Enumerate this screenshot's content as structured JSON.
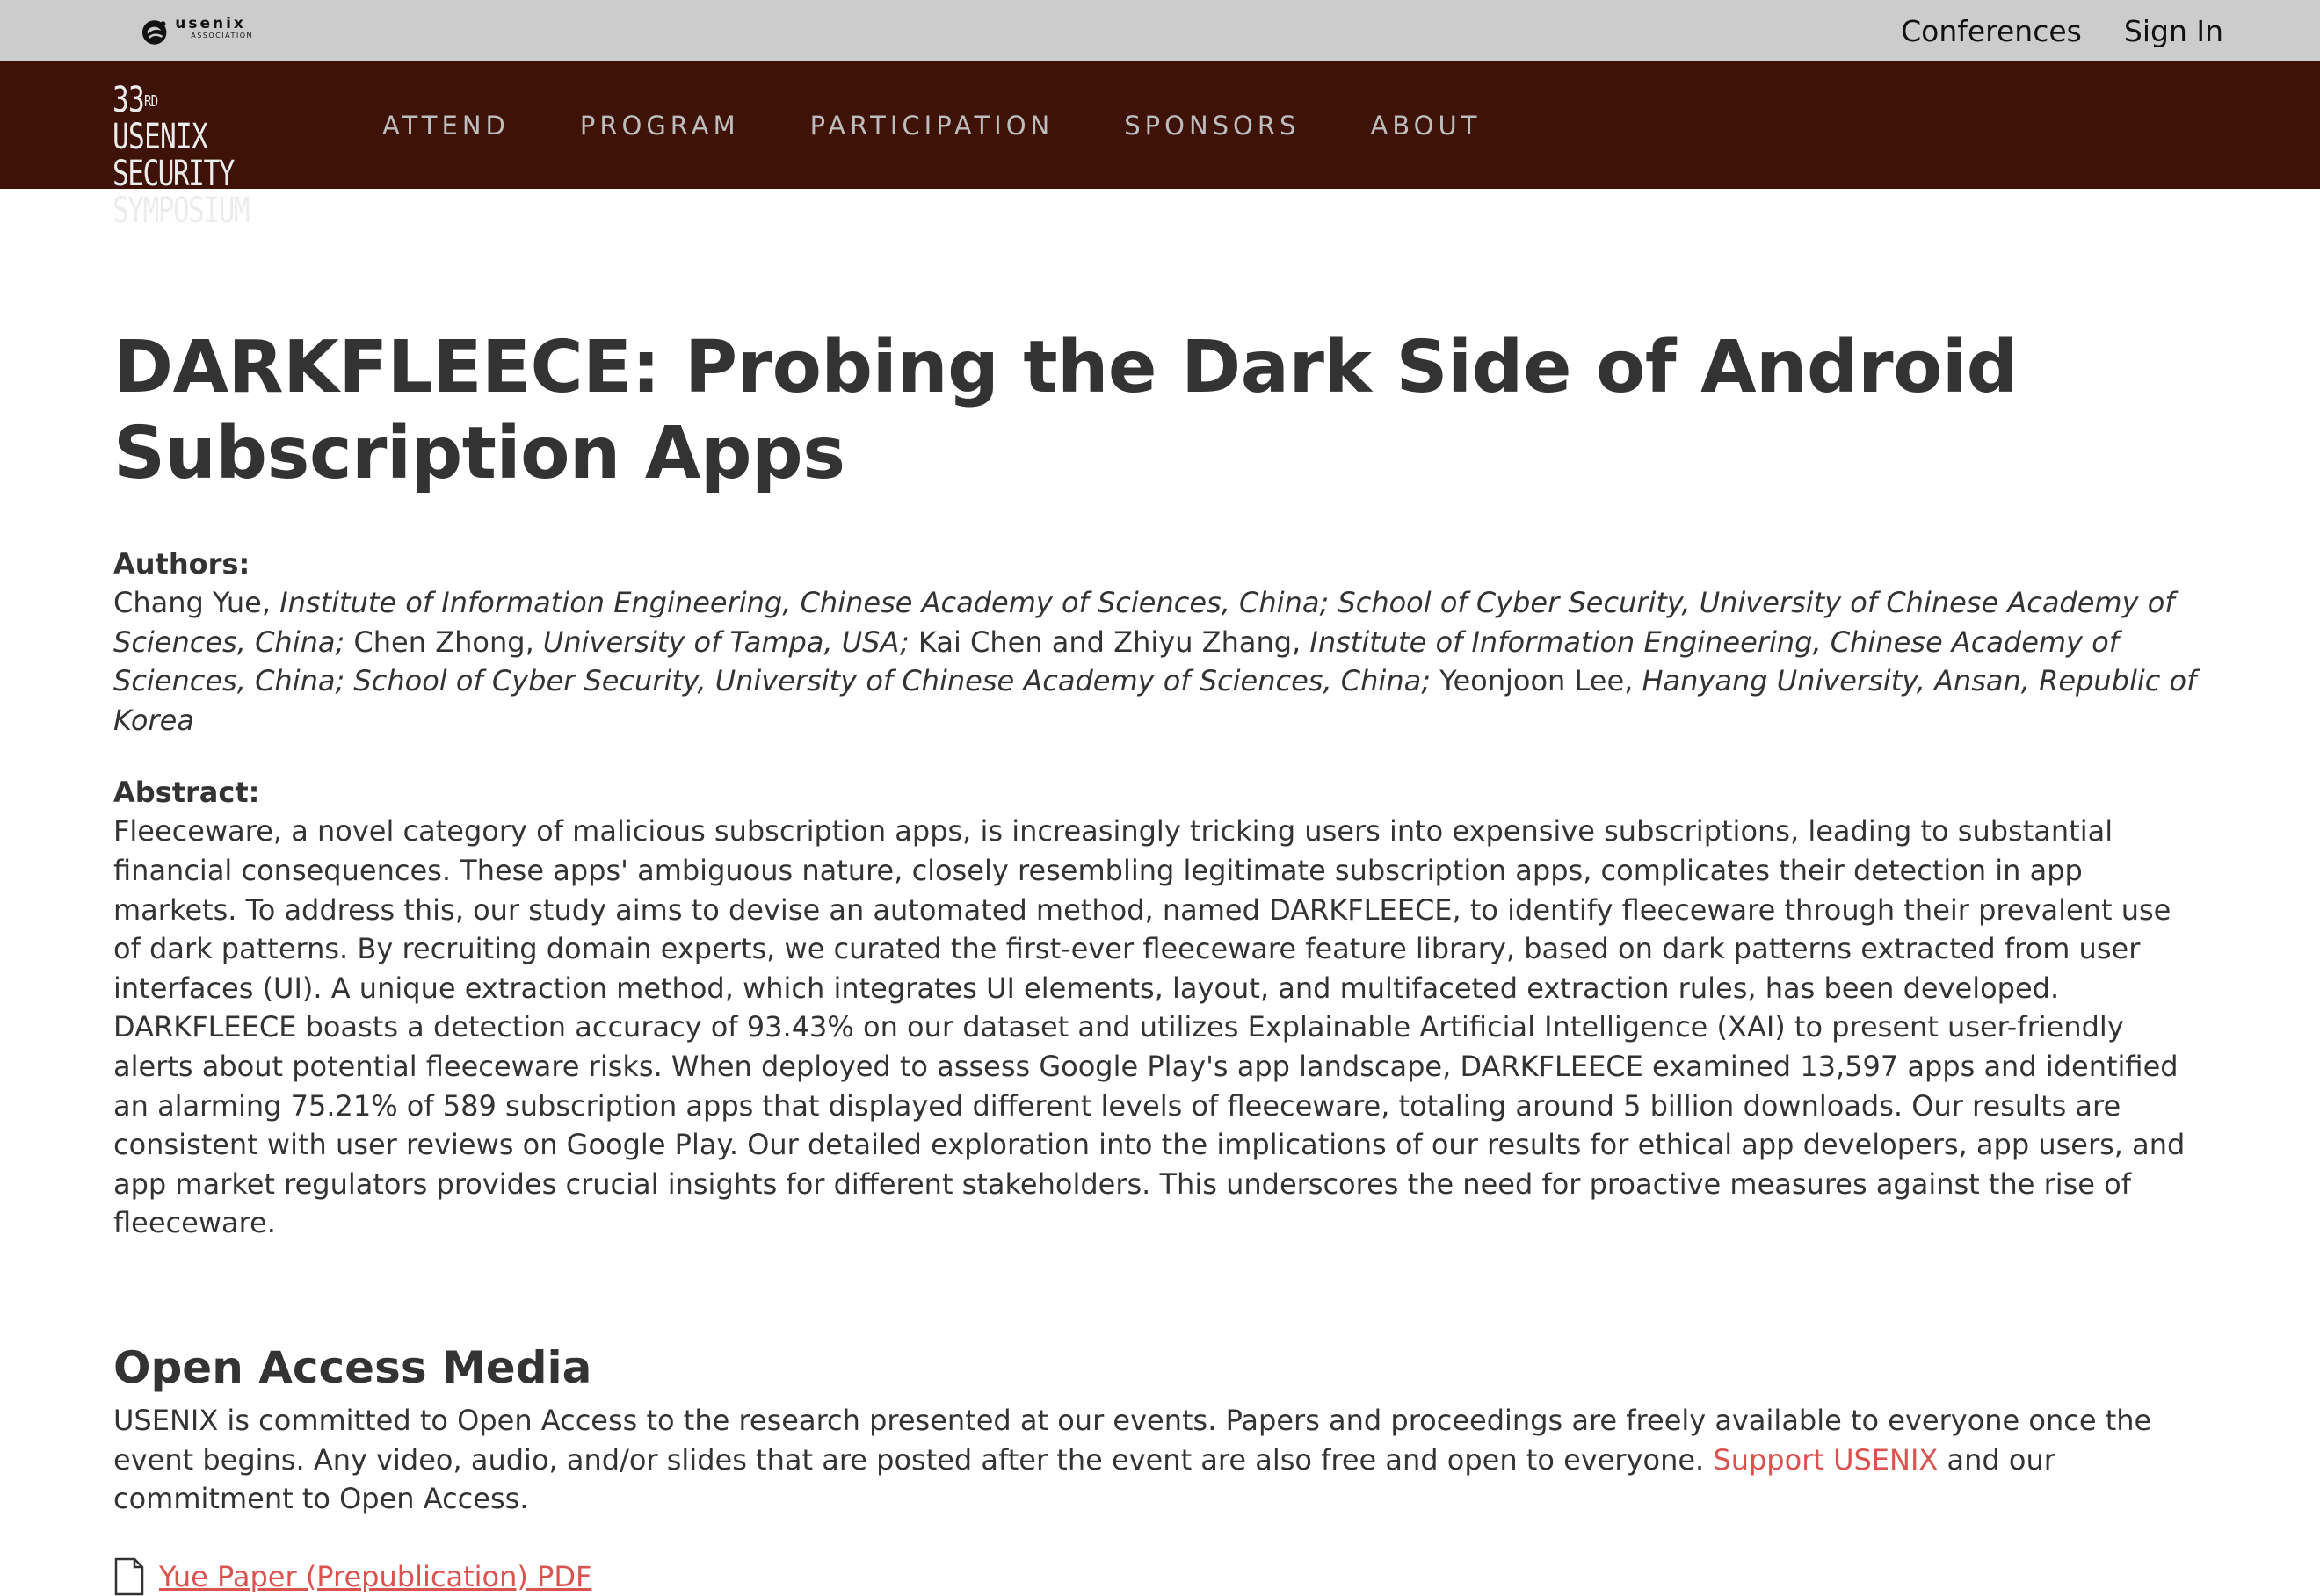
{
  "topbar": {
    "logo_word": "usenix",
    "logo_sub": "ASSOCIATION",
    "links": [
      "Conferences",
      "Sign In"
    ]
  },
  "navbar": {
    "logo_line1_prefix": "33",
    "logo_line1_sup": "RD",
    "logo_line1_suffix": " USENIX",
    "logo_line2": "SECURITY SYMPOSIUM",
    "items": [
      "ATTEND",
      "PROGRAM",
      "PARTICIPATION",
      "SPONSORS",
      "ABOUT"
    ],
    "bg_color": "#3f1208"
  },
  "paper": {
    "title": "DARKFLEECE: Probing the Dark Side of Android Subscription Apps",
    "authors_label": "Authors:",
    "authors": [
      {
        "text": "Chang Yue, ",
        "italic": false
      },
      {
        "text": "Institute of Information Engineering, Chinese Academy of Sciences, China; School of Cyber Security, University of Chinese Academy of Sciences, China;",
        "italic": true
      },
      {
        "text": " Chen Zhong, ",
        "italic": false
      },
      {
        "text": "University of Tampa, USA;",
        "italic": true
      },
      {
        "text": " Kai Chen and Zhiyu Zhang, ",
        "italic": false
      },
      {
        "text": "Institute of Information Engineering, Chinese Academy of Sciences, China; School of Cyber Security, University of Chinese Academy of Sciences, China;",
        "italic": true
      },
      {
        "text": " Yeonjoon Lee, ",
        "italic": false
      },
      {
        "text": "Hanyang University, Ansan, Republic of Korea",
        "italic": true
      }
    ],
    "abstract_label": "Abstract:",
    "abstract": "Fleeceware, a novel category of malicious subscription apps, is increasingly tricking users into expensive subscriptions, leading to substantial financial consequences. These apps' ambiguous nature, closely resembling legitimate subscription apps, complicates their detection in app markets. To address this, our study aims to devise an automated method, named DARKFLEECE, to identify fleeceware through their prevalent use of dark patterns. By recruiting domain experts, we curated the first-ever fleeceware feature library, based on dark patterns extracted from user interfaces (UI). A unique extraction method, which integrates UI elements, layout, and multifaceted extraction rules, has been developed. DARKFLEECE boasts a detection accuracy of 93.43% on our dataset and utilizes Explainable Artificial Intelligence (XAI) to present user-friendly alerts about potential fleeceware risks. When deployed to assess Google Play's app landscape, DARKFLEECE examined 13,597 apps and identified an alarming 75.21% of 589 subscription apps that displayed different levels of fleeceware, totaling around 5 billion downloads. Our results are consistent with user reviews on Google Play. Our detailed exploration into the implications of our results for ethical app developers, app users, and app market regulators provides crucial insights for different stakeholders. This underscores the need for proactive measures against the rise of fleeceware."
  },
  "open_access": {
    "heading": "Open Access Media",
    "text_before": "USENIX is committed to Open Access to the research presented at our events. Papers and proceedings are freely available to everyone once the event begins. Any video, audio, and/or slides that are posted after the event are also free and open to everyone. ",
    "link_text": "Support USENIX",
    "text_after": " and our commitment to Open Access.",
    "link_color": "#d9534f",
    "pdf_link": "Yue Paper (Prepublication) PDF"
  }
}
